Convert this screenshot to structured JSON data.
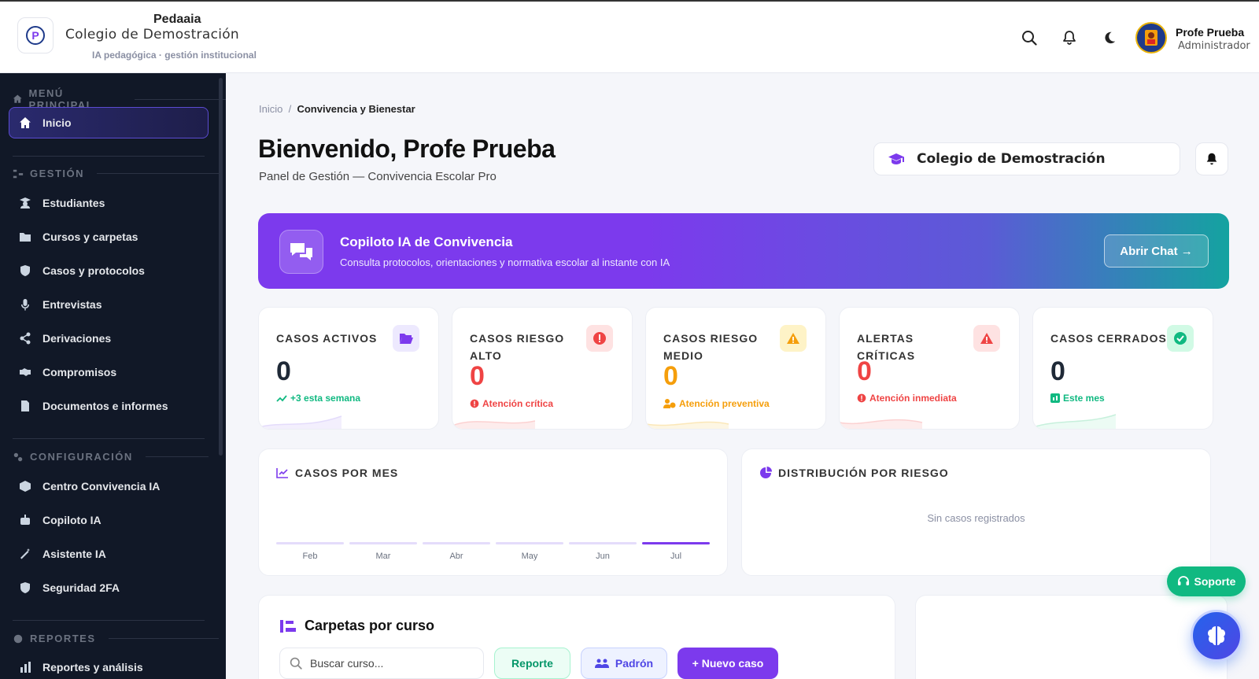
{
  "header": {
    "brand": "Pedaaia",
    "school": "Colegio de Demostración",
    "tagline": "IA pedagógica · gestión institucional",
    "user_name": "Profe Prueba",
    "user_role": "Administrador"
  },
  "sidebar": {
    "sections": {
      "main": "MENÚ PRINCIPAL",
      "gestion": "GESTIÓN",
      "config": "CONFIGURACIÓN",
      "reportes": "REPORTES"
    },
    "items": [
      {
        "label": "Inicio",
        "icon": "home-icon"
      },
      {
        "label": "Estudiantes",
        "icon": "student-icon"
      },
      {
        "label": "Cursos y carpetas",
        "icon": "folder-icon"
      },
      {
        "label": "Casos y protocolos",
        "icon": "shield-icon"
      },
      {
        "label": "Entrevistas",
        "icon": "microphone-icon"
      },
      {
        "label": "Derivaciones",
        "icon": "share-icon"
      },
      {
        "label": "Compromisos",
        "icon": "handshake-icon"
      },
      {
        "label": "Documentos e informes",
        "icon": "document-icon"
      },
      {
        "label": "Centro Convivencia IA",
        "icon": "box-icon"
      },
      {
        "label": "Copiloto IA",
        "icon": "robot-icon"
      },
      {
        "label": "Asistente IA",
        "icon": "magic-wand-icon"
      },
      {
        "label": "Seguridad 2FA",
        "icon": "shield-half-icon"
      },
      {
        "label": "Reportes y análisis",
        "icon": "chart-icon"
      }
    ]
  },
  "main": {
    "breadcrumb_home": "Inicio",
    "breadcrumb_sep": "/",
    "breadcrumb_current": "Convivencia y Bienestar",
    "welcome": "Bienvenido, Profe Prueba",
    "subtitle": "Panel de Gestión — Convivencia Escolar Pro",
    "school_pill": "Colegio de Demostración"
  },
  "copilot": {
    "title": "Copiloto IA de Convivencia",
    "description": "Consulta protocolos, orientaciones y normativa escolar al instante con IA",
    "button": "Abrir Chat →"
  },
  "stats": [
    {
      "title": "CASOS ACTIVOS",
      "value": "0",
      "note": "+3 esta semana",
      "color": "#111111",
      "note_color": "#10b981"
    },
    {
      "title": "CASOS RIESGO ALTO",
      "value": "0",
      "note": "Atención crítica",
      "color": "#ef4444",
      "note_color": "#ef4444"
    },
    {
      "title": "CASOS RIESGO MEDIO",
      "value": "0",
      "note": "Atención preventiva",
      "color": "#f59e0b",
      "note_color": "#f59e0b"
    },
    {
      "title": "ALERTAS CRÍTICAS",
      "value": "0",
      "note": "Atención inmediata",
      "color": "#ef4444",
      "note_color": "#ef4444"
    },
    {
      "title": "CASOS CERRADOS",
      "value": "0",
      "note": "Este mes",
      "color": "#111111",
      "note_color": "#10b981"
    }
  ],
  "charts": {
    "cases_title": "CASOS POR MES",
    "dist_title": "DISTRIBUCIÓN POR RIESGO",
    "dist_empty": "Sin casos registrados"
  },
  "chart_data": {
    "type": "bar",
    "title": "CASOS POR MES",
    "categories": [
      "Feb",
      "Mar",
      "Abr",
      "May",
      "Jun",
      "Jul"
    ],
    "highlighted": "Jul",
    "xlabel": "",
    "ylabel": ""
  },
  "folders": {
    "title": "Carpetas por curso",
    "search_placeholder": "Buscar curso...",
    "report_btn": "Reporte",
    "padron_btn": "Padrón",
    "new_case_btn": "+ Nuevo caso"
  },
  "support": {
    "label": "Soporte"
  },
  "colors": {
    "accent": "#7c3aed",
    "success": "#10b981",
    "danger": "#ef4444",
    "warning": "#f59e0b"
  }
}
